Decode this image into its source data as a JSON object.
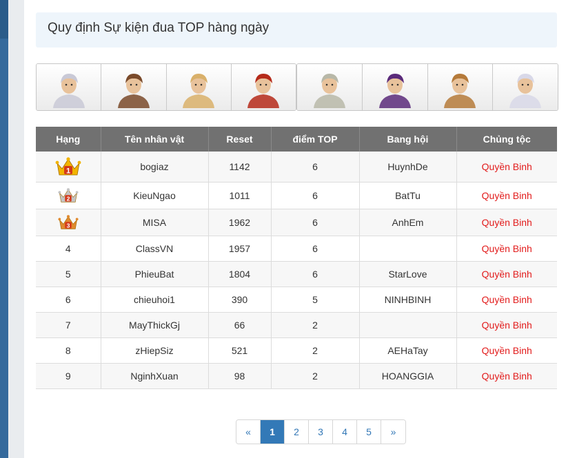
{
  "notice": {
    "title": "Quy định Sự kiện đua TOP hàng ngày"
  },
  "classes": [
    {
      "icon": "class-portrait-1",
      "color": "#c9c9d6"
    },
    {
      "icon": "class-portrait-2",
      "color": "#7a4a2a"
    },
    {
      "icon": "class-portrait-3",
      "color": "#d9b06a"
    },
    {
      "icon": "class-portrait-4",
      "color": "#b52a1a"
    },
    {
      "icon": "class-portrait-5",
      "color": "#b8b8a8"
    },
    {
      "icon": "class-portrait-6",
      "color": "#5a2a7a"
    },
    {
      "icon": "class-portrait-7",
      "color": "#b57a3a"
    },
    {
      "icon": "class-portrait-8",
      "color": "#d8d8e8"
    }
  ],
  "table": {
    "headers": [
      "Hạng",
      "Tên nhân vật",
      "Reset",
      "điểm TOP",
      "Bang hội",
      "Chủng tộc"
    ],
    "rows": [
      {
        "rank": "1",
        "name": "bogiaz",
        "reset": "1142",
        "top": "6",
        "guild": "HuynhDe",
        "race": "Quyền Binh"
      },
      {
        "rank": "2",
        "name": "KieuNgao",
        "reset": "1011",
        "top": "6",
        "guild": "BatTu",
        "race": "Quyền Binh"
      },
      {
        "rank": "3",
        "name": "MISA",
        "reset": "1962",
        "top": "6",
        "guild": "AnhEm",
        "race": "Quyền Binh"
      },
      {
        "rank": "4",
        "name": "ClassVN",
        "reset": "1957",
        "top": "6",
        "guild": "",
        "race": "Quyền Binh"
      },
      {
        "rank": "5",
        "name": "PhieuBat",
        "reset": "1804",
        "top": "6",
        "guild": "StarLove",
        "race": "Quyền Binh"
      },
      {
        "rank": "6",
        "name": "chieuhoi1",
        "reset": "390",
        "top": "5",
        "guild": "NINHBINH",
        "race": "Quyền Binh"
      },
      {
        "rank": "7",
        "name": "MayThickGj",
        "reset": "66",
        "top": "2",
        "guild": "",
        "race": "Quyền Binh"
      },
      {
        "rank": "8",
        "name": "zHiepSiz",
        "reset": "521",
        "top": "2",
        "guild": "AEHaTay",
        "race": "Quyền Binh"
      },
      {
        "rank": "9",
        "name": "NginhXuan",
        "reset": "98",
        "top": "2",
        "guild": "HOANGGIA",
        "race": "Quyền Binh"
      }
    ],
    "medals": {
      "1": {
        "icon": "gold-crown-icon",
        "color": "#f2b400"
      },
      "2": {
        "icon": "silver-crown-icon",
        "color": "#c4c4c4"
      },
      "3": {
        "icon": "bronze-crown-icon",
        "color": "#e08a2e"
      }
    }
  },
  "pagination": {
    "prev": "«",
    "pages": [
      "1",
      "2",
      "3",
      "4",
      "5"
    ],
    "current": "1",
    "next": "»"
  }
}
